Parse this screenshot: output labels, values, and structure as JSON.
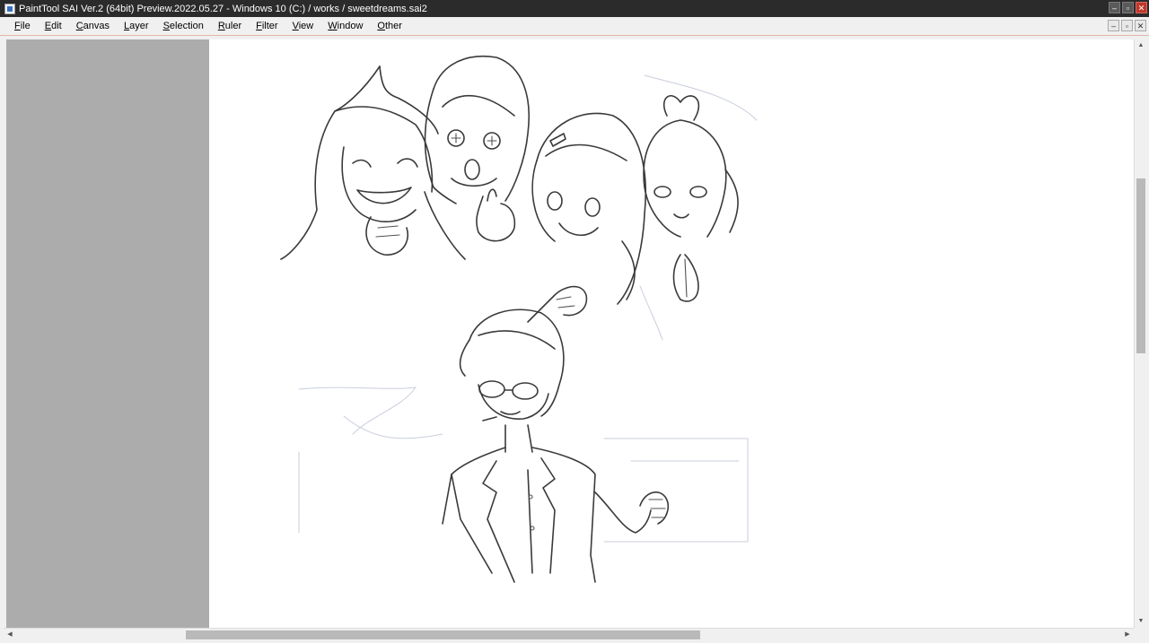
{
  "window": {
    "title": "PaintTool SAI Ver.2 (64bit) Preview.2022.05.27 - Windows 10 (C:) / works / sweetdreams.sai2",
    "controls": {
      "minimize": "–",
      "restore": "▫",
      "close": "✕"
    }
  },
  "menu": {
    "items": [
      {
        "accel": "F",
        "rest": "ile"
      },
      {
        "accel": "E",
        "rest": "dit"
      },
      {
        "accel": "C",
        "rest": "anvas"
      },
      {
        "accel": "L",
        "rest": "ayer"
      },
      {
        "accel": "S",
        "rest": "election"
      },
      {
        "accel": "R",
        "rest": "uler"
      },
      {
        "accel": "F",
        "rest": "ilter"
      },
      {
        "accel": "V",
        "rest": "iew"
      },
      {
        "accel": "W",
        "rest": "indow"
      },
      {
        "accel": "O",
        "rest": "ther"
      }
    ],
    "doc_controls": {
      "minimize": "–",
      "restore": "▫",
      "close": "✕"
    }
  },
  "scrollbars": {
    "up": "▲",
    "down": "▼",
    "left": "◀",
    "right": "▶"
  },
  "colors": {
    "titlebar": "#2b2b2b",
    "menubar": "#f0f0f0",
    "canvas_outside": "#acacac",
    "paper": "#ffffff",
    "ink": "#3a3a3a",
    "sketch": "#c9cede"
  },
  "icons": [
    "app-icon",
    "minimize-icon",
    "restore-icon",
    "close-icon"
  ]
}
